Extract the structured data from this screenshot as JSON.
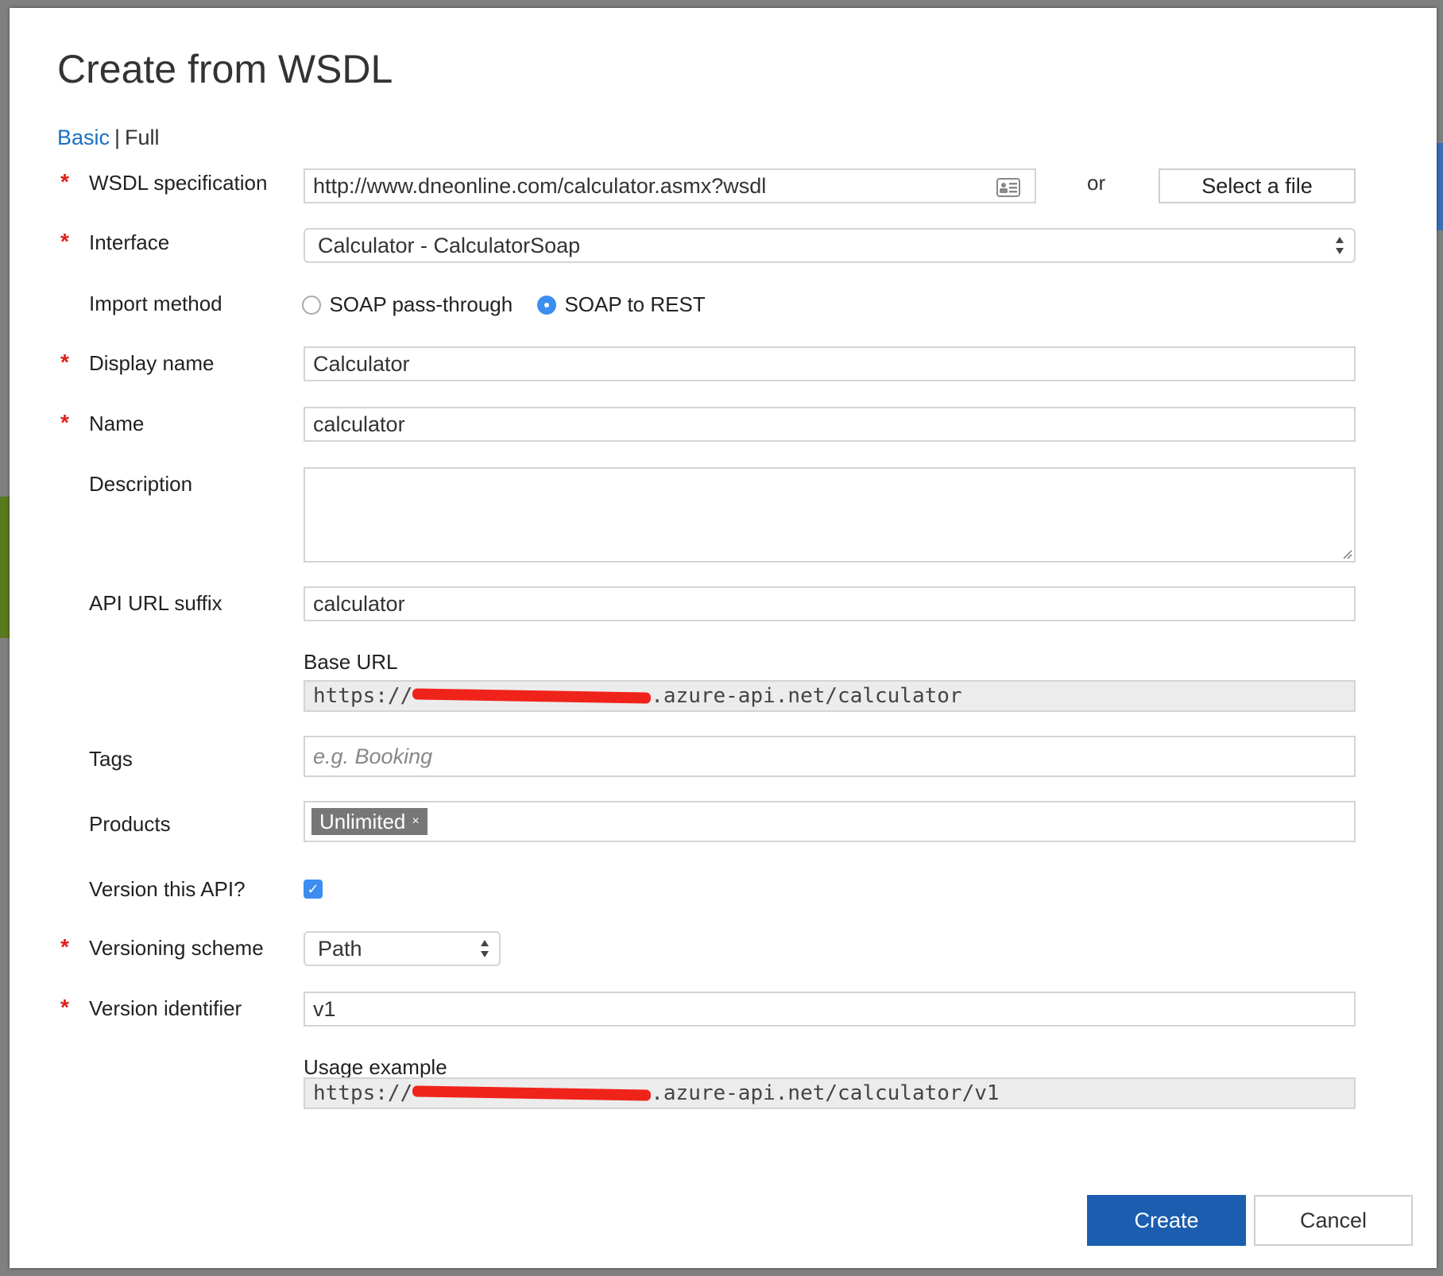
{
  "dialog": {
    "title": "Create from WSDL",
    "mode_basic": "Basic",
    "mode_separator": "|",
    "mode_full": "Full"
  },
  "form": {
    "wsdl": {
      "label": "WSDL specification",
      "value": "http://www.dneonline.com/calculator.asmx?wsdl",
      "or_text": "or",
      "select_file_label": "Select a file"
    },
    "interface": {
      "label": "Interface",
      "value": "Calculator - CalculatorSoap"
    },
    "import_method": {
      "label": "Import method",
      "options": [
        {
          "label": "SOAP pass-through",
          "checked": false
        },
        {
          "label": "SOAP to REST",
          "checked": true
        }
      ]
    },
    "display_name": {
      "label": "Display name",
      "value": "Calculator"
    },
    "name": {
      "label": "Name",
      "value": "calculator"
    },
    "description": {
      "label": "Description",
      "value": ""
    },
    "api_url_suffix": {
      "label": "API URL suffix",
      "value": "calculator"
    },
    "base_url": {
      "label": "Base URL",
      "prefix": "https://",
      "suffix": ".azure-api.net/calculator"
    },
    "tags": {
      "label": "Tags",
      "placeholder": "e.g. Booking"
    },
    "products": {
      "label": "Products",
      "chips": [
        "Unlimited"
      ],
      "remove_glyph": "×"
    },
    "version_api": {
      "label": "Version this API?",
      "checked": true,
      "check_glyph": "✓"
    },
    "versioning_scheme": {
      "label": "Versioning scheme",
      "value": "Path"
    },
    "version_identifier": {
      "label": "Version identifier",
      "value": "v1"
    },
    "usage_example": {
      "label": "Usage example",
      "prefix": "https://",
      "suffix": ".azure-api.net/calculator/v1"
    },
    "required_marker": "*"
  },
  "footer": {
    "create_label": "Create",
    "cancel_label": "Cancel"
  },
  "colors": {
    "accent": "#1b5eb0",
    "link": "#1a6fc4",
    "required": "#e0201b",
    "radio_checked": "#3b8ef0"
  }
}
